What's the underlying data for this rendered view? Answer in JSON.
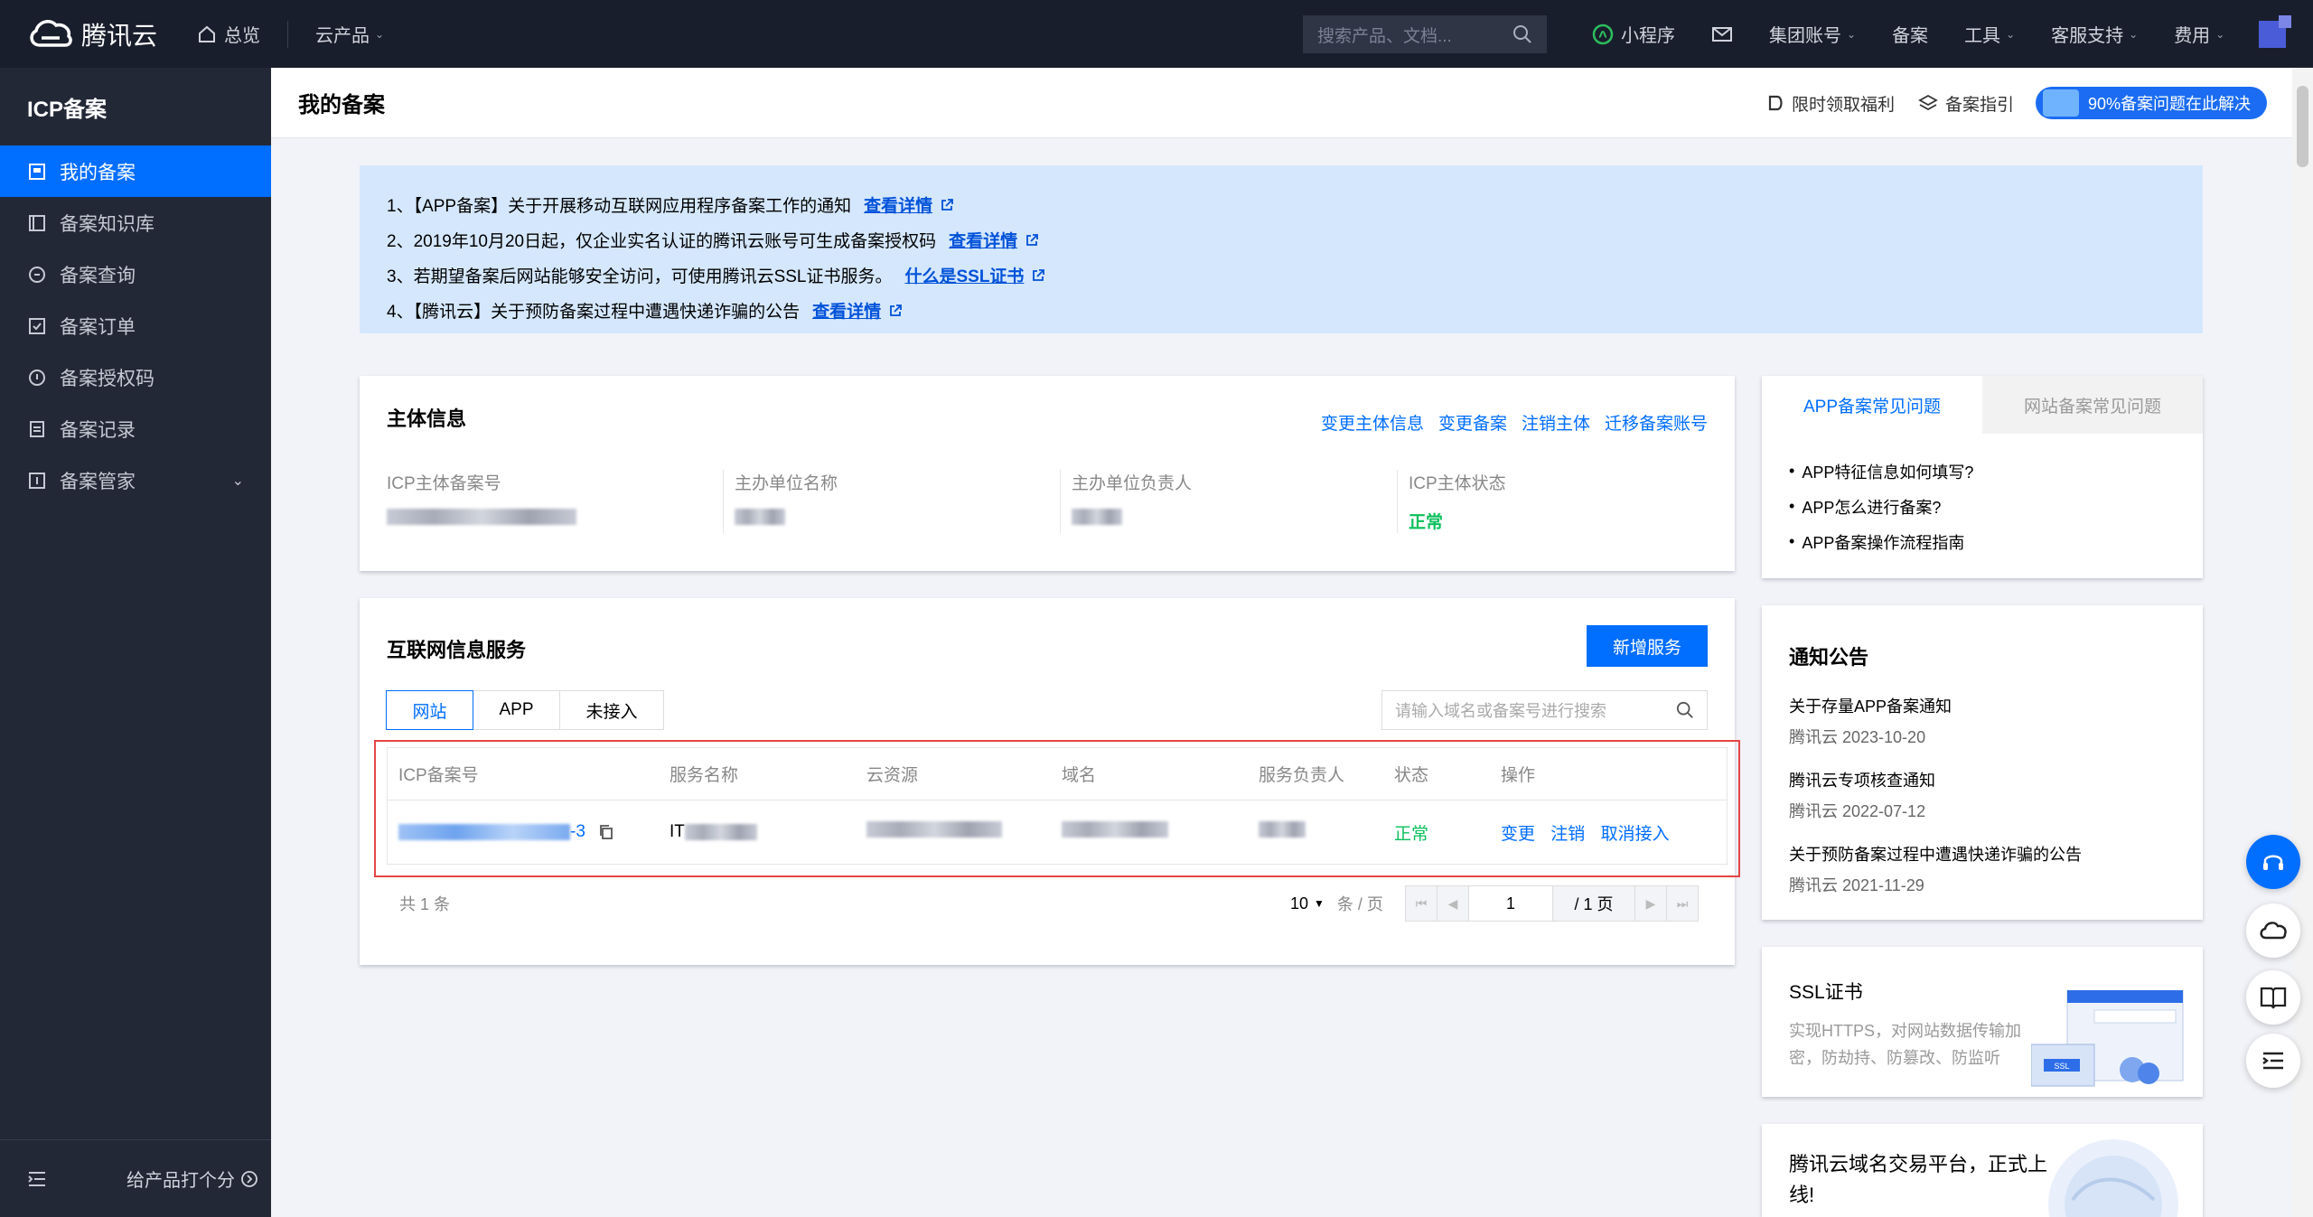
{
  "topbar": {
    "brand": "腾讯云",
    "overview": "总览",
    "products": "云产品",
    "search_placeholder": "搜索产品、文档...",
    "mini_program": "小程序",
    "group_account": "集团账号",
    "beian": "备案",
    "tools": "工具",
    "support": "客服支持",
    "fees": "费用"
  },
  "sidebar": {
    "title": "ICP备案",
    "items": [
      {
        "label": "我的备案",
        "icon": "my-beian-icon"
      },
      {
        "label": "备案知识库",
        "icon": "knowledge-icon"
      },
      {
        "label": "备案查询",
        "icon": "search-icon"
      },
      {
        "label": "备案订单",
        "icon": "order-icon"
      },
      {
        "label": "备案授权码",
        "icon": "auth-code-icon"
      },
      {
        "label": "备案记录",
        "icon": "record-icon"
      },
      {
        "label": "备案管家",
        "icon": "manager-icon"
      }
    ],
    "rate_label": "给产品打个分"
  },
  "header": {
    "title": "我的备案",
    "welfare": "限时领取福利",
    "guide": "备案指引",
    "help": "90%备案问题在此解决"
  },
  "notices": {
    "items": [
      {
        "text": "1、【APP备案】关于开展移动互联网应用程序备案工作的通知",
        "link": "查看详情"
      },
      {
        "text": "2、2019年10月20日起，仅企业实名认证的腾讯云账号可生成备案授权码",
        "link": "查看详情"
      },
      {
        "text": "3、若期望备案后网站能够安全访问，可使用腾讯云SSL证书服务。",
        "link": "什么是SSL证书"
      },
      {
        "text": "4、【腾讯云】关于预防备案过程中遭遇快递诈骗的公告",
        "link": "查看详情"
      }
    ]
  },
  "subject": {
    "title": "主体信息",
    "actions": [
      "变更主体信息",
      "变更备案",
      "注销主体",
      "迁移备案账号"
    ],
    "fields": [
      {
        "label": "ICP主体备案号"
      },
      {
        "label": "主办单位名称"
      },
      {
        "label": "主办单位负责人"
      },
      {
        "label": "ICP主体状态",
        "value": "正常"
      }
    ]
  },
  "services": {
    "title": "互联网信息服务",
    "add_button": "新增服务",
    "tabs": [
      "网站",
      "APP",
      "未接入"
    ],
    "search_placeholder": "请输入域名或备案号进行搜索",
    "columns": [
      "ICP备案号",
      "服务名称",
      "云资源",
      "域名",
      "服务负责人",
      "状态",
      "操作"
    ],
    "row": {
      "icp_suffix": "-3",
      "service_prefix": "IT",
      "status": "正常",
      "ops": [
        "变更",
        "注销",
        "取消接入"
      ]
    },
    "pager": {
      "total": "共 1 条",
      "page_size": "10",
      "page_size_unit": "条 / 页",
      "current_page": "1",
      "total_pages": "/ 1 页"
    }
  },
  "faq": {
    "tabs": [
      "APP备案常见问题",
      "网站备案常见问题"
    ],
    "items": [
      "APP特征信息如何填写?",
      "APP怎么进行备案?",
      "APP备案操作流程指南"
    ]
  },
  "announcements": {
    "title": "通知公告",
    "items": [
      {
        "title": "关于存量APP备案通知",
        "date": "腾讯云 2023-10-20"
      },
      {
        "title": "腾讯云专项核查通知",
        "date": "腾讯云 2022-07-12"
      },
      {
        "title": "关于预防备案过程中遭遇快递诈骗的公告",
        "date": "腾讯云 2021-11-29"
      }
    ]
  },
  "ssl": {
    "title": "SSL证书",
    "desc": "实现HTTPS，对网站数据传输加密，防劫持、防篡改、防监听",
    "art_label": "SSL"
  },
  "domain_promo": {
    "title": "腾讯云域名交易平台，正式上线!"
  },
  "colors": {
    "brand_blue": "#006eff",
    "topbar_bg": "#191e2c",
    "sidebar_bg": "#232837",
    "status_green": "#0abf5b",
    "highlight_red": "#e54545"
  }
}
